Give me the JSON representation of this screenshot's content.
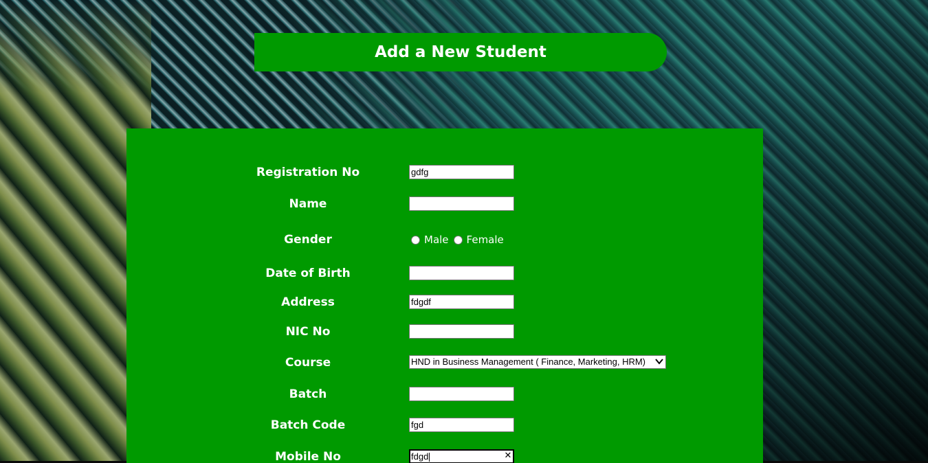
{
  "page": {
    "title": "Add a New Student"
  },
  "form": {
    "registration_no": {
      "label": "Registration No",
      "value": "gdfg"
    },
    "name": {
      "label": "Name",
      "value": ""
    },
    "gender": {
      "label": "Gender",
      "options": [
        "Male",
        "Female"
      ],
      "selected": null
    },
    "date_of_birth": {
      "label": "Date of Birth",
      "value": ""
    },
    "address": {
      "label": "Address",
      "value": "fdgdf"
    },
    "nic_no": {
      "label": "NIC No",
      "value": ""
    },
    "course": {
      "label": "Course",
      "selected": "HND in Business Management ( Finance, Marketing, HRM)"
    },
    "batch": {
      "label": "Batch",
      "value": ""
    },
    "batch_code": {
      "label": "Batch Code",
      "value": "fgd"
    },
    "mobile_no": {
      "label": "Mobile No",
      "value": "fdgd"
    }
  },
  "icons": {
    "clear": "close-icon",
    "select_arrow": "chevron-down-icon"
  },
  "colors": {
    "panel": "#009a00",
    "label_text": "#ffffff"
  }
}
